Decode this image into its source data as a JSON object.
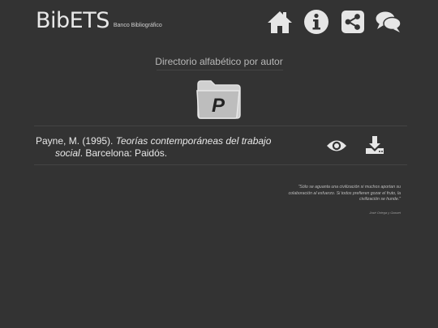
{
  "header": {
    "logo": "BibETS",
    "logo_sub": "Banco Bibliográfico",
    "nav": [
      {
        "icon": "home-icon"
      },
      {
        "icon": "info-icon"
      },
      {
        "icon": "share-icon"
      },
      {
        "icon": "chat-icon"
      }
    ]
  },
  "directory": {
    "title": "Directorio alfabético por autor",
    "letter": "P"
  },
  "entry": {
    "author_year": "Payne, M. (1995). ",
    "title_part1": "Teorías contemporáneas del trabajo",
    "title_part2": "social",
    "publisher": ". Barcelona: Paidós.",
    "actions": [
      {
        "icon": "eye-icon"
      },
      {
        "icon": "download-icon"
      }
    ]
  },
  "quote": {
    "text": "\"Sólo se aguanta una civilización si muchos aportan su colaboración al esfuerzo. Si todos prefieren gozar el fruto, la civilización se hunde.\"",
    "author": "José Ortega y Gasset"
  },
  "colors": {
    "background": "#333333",
    "icon": "#e6e6e6"
  }
}
